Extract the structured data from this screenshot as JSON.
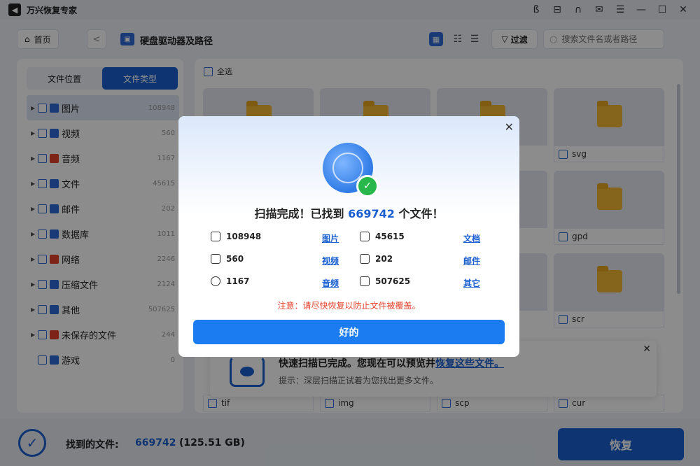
{
  "app": {
    "title": "万兴恢复专家",
    "logo_glyph": "◀"
  },
  "window_controls": [
    "user-icon",
    "login-icon",
    "headset-icon",
    "mail-icon",
    "menu-icon",
    "minimize-icon",
    "maximize-icon",
    "close-icon"
  ],
  "toolbar": {
    "home_label": "首页",
    "back_glyph": "<",
    "path_title": "硬盘驱动器及路径",
    "filter_label": "过滤",
    "search_placeholder": "搜索文件名或者路径"
  },
  "sidebar": {
    "tabs": [
      {
        "label": "文件位置",
        "active": false
      },
      {
        "label": "文件类型",
        "active": true
      }
    ],
    "categories": [
      {
        "label": "图片",
        "count": "108948",
        "color": "#2f6ad8",
        "selected": true
      },
      {
        "label": "视频",
        "count": "560",
        "color": "#2f6ad8"
      },
      {
        "label": "音频",
        "count": "1167",
        "color": "#e5412d"
      },
      {
        "label": "文件",
        "count": "45615",
        "color": "#2f6ad8"
      },
      {
        "label": "邮件",
        "count": "202",
        "color": "#2f6ad8"
      },
      {
        "label": "数据库",
        "count": "1011",
        "color": "#2f6ad8"
      },
      {
        "label": "网络",
        "count": "2246",
        "color": "#e5412d"
      },
      {
        "label": "压缩文件",
        "count": "2124",
        "color": "#2f6ad8"
      },
      {
        "label": "其他",
        "count": "507625",
        "color": "#2f6ad8"
      },
      {
        "label": "未保存的文件",
        "count": "244",
        "color": "#e5412d"
      },
      {
        "label": "游戏",
        "count": "0",
        "color": "#2f6ad8"
      }
    ]
  },
  "content": {
    "select_all": "全选",
    "tiles": [
      {
        "label": "svg"
      },
      {
        "label": "gpd"
      },
      {
        "label": "scr"
      },
      {
        "label": "tif"
      },
      {
        "label": "img"
      },
      {
        "label": "scp"
      },
      {
        "label": "cur"
      }
    ]
  },
  "toast": {
    "title_text": "快速扫描已完成。您现在可以预览并",
    "title_link": "恢复这些文件。",
    "subtitle": "提示：深层扫描正试着为您找出更多文件。",
    "close_glyph": "✕"
  },
  "bottom": {
    "found_label": "找到的文件:",
    "found_count": "669742",
    "found_size": "(125.51 GB)",
    "recover_label": "恢复"
  },
  "modal": {
    "title_prefix": "扫描完成！已找到",
    "title_count": "669742",
    "title_suffix": "个文件！",
    "stats": [
      {
        "icon": "image-icon",
        "value": "108948",
        "link": "图片"
      },
      {
        "icon": "document-icon",
        "value": "45615",
        "link": "文档"
      },
      {
        "icon": "video-icon",
        "value": "560",
        "link": "视频"
      },
      {
        "icon": "mail-icon",
        "value": "202",
        "link": "邮件"
      },
      {
        "icon": "audio-icon",
        "value": "1167",
        "link": "音频"
      },
      {
        "icon": "other-icon",
        "value": "507625",
        "link": "其它"
      }
    ],
    "warning": "注意：请尽快恢复以防止文件被覆盖。",
    "ok_label": "好的",
    "close_glyph": "✕"
  }
}
